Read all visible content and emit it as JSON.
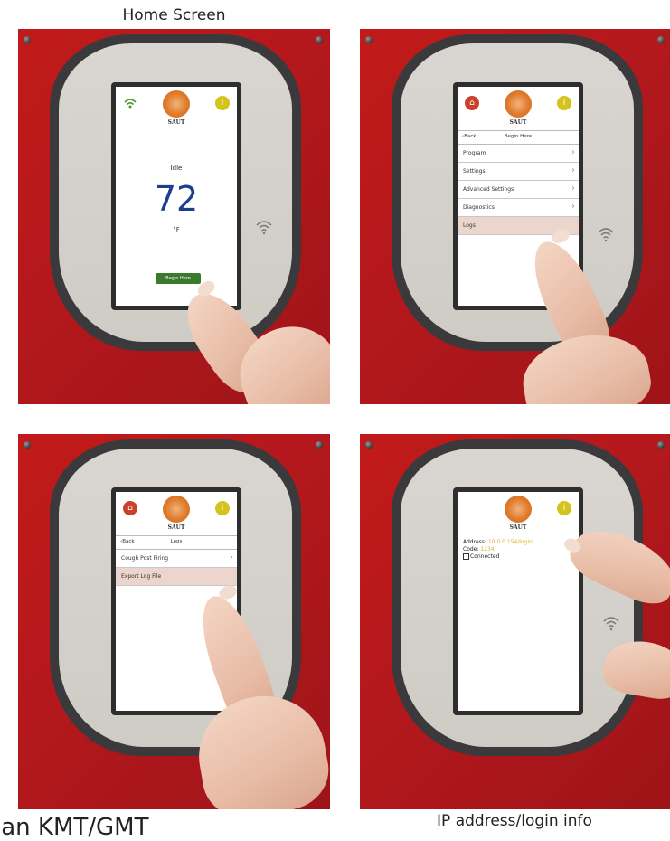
{
  "captions": {
    "top": "Home Screen",
    "bottom_right": "IP address/login info",
    "bottom_left": "lan KMT/GMT"
  },
  "brand": "SAUT",
  "icons": {
    "wifi": "wifi-icon",
    "info": "info-icon",
    "home": "home-icon",
    "logo": "logo-icon"
  },
  "panel1": {
    "status": "Idle",
    "temperature": "72",
    "unit": "°F",
    "button": "Begin Here"
  },
  "panel2": {
    "back": "Back",
    "title": "Begin Here",
    "menu": [
      {
        "label": "Program",
        "selected": false
      },
      {
        "label": "Settings",
        "selected": false
      },
      {
        "label": "Advanced Settings",
        "selected": false
      },
      {
        "label": "Diagnostics",
        "selected": false
      },
      {
        "label": "Logs",
        "selected": true
      }
    ]
  },
  "panel3": {
    "back": "Back",
    "title": "Logs",
    "menu": [
      {
        "label": "Cough Post Firing",
        "selected": false
      },
      {
        "label": "Export Log File",
        "selected": true
      }
    ]
  },
  "panel4": {
    "address_label": "Address:",
    "address_value": "10.0.0.154/login",
    "code_label": "Code:",
    "code_value": "1234",
    "connected_label": "Connected"
  },
  "colors": {
    "panel_red": "#b3181c",
    "temp_blue": "#1d3d8f",
    "button_green": "#3a7a2d",
    "accent_yellow": "#d4c31c",
    "selected_row": "#ecd5cc"
  }
}
